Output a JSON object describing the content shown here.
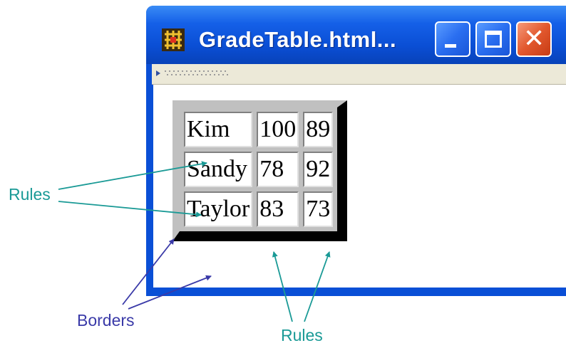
{
  "window": {
    "title": "GradeTable.html...",
    "app_icon": "web-page-icon",
    "buttons": {
      "minimize_icon": "minimize-icon",
      "maximize_icon": "maximize-icon",
      "close_icon": "close-icon",
      "close_glyph": "✕"
    }
  },
  "table": {
    "rows": [
      {
        "name": "Kim",
        "score1": "100",
        "score2": "89"
      },
      {
        "name": "Sandy",
        "score1": "78",
        "score2": "92"
      },
      {
        "name": "Taylor",
        "score1": "83",
        "score2": "73"
      }
    ]
  },
  "annotations": {
    "rules_left": "Rules",
    "borders": "Borders",
    "rules_bottom": "Rules"
  },
  "colors": {
    "rules_annotation": "#1a9a96",
    "borders_annotation": "#3a3aa8",
    "titlebar": "#0a4ed4",
    "close_button": "#e2582e"
  }
}
